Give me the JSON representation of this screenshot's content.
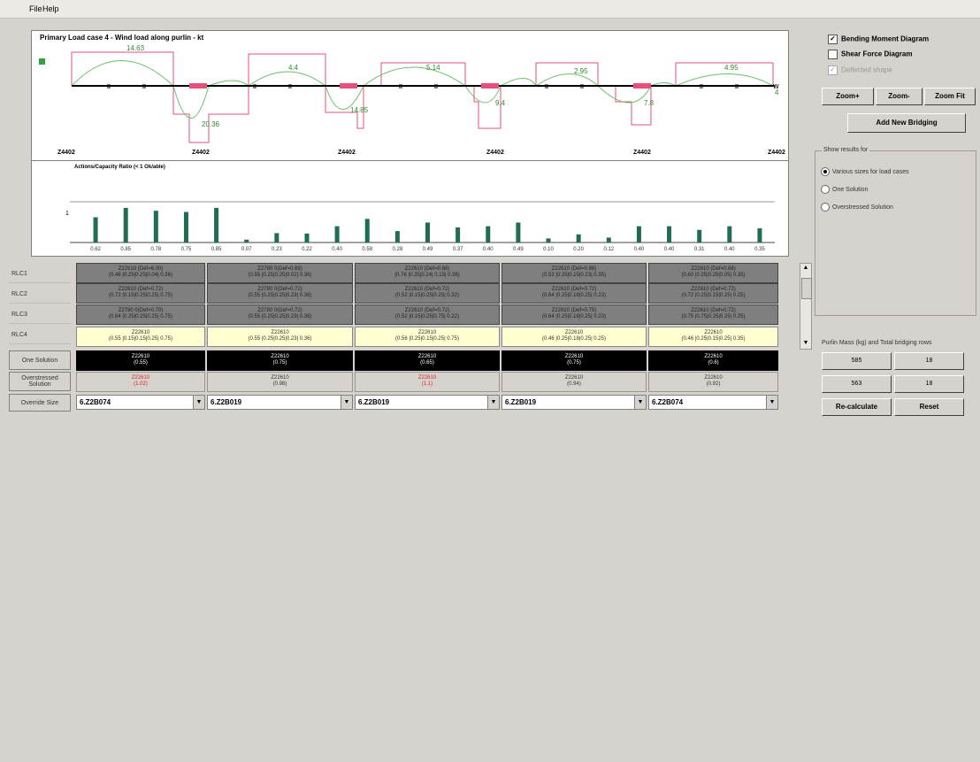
{
  "menu": {
    "file": "File",
    "help": "Help"
  },
  "bm_chart": {
    "title": "Primary Load case 4 - Wind load along purlin - kt",
    "moment_labels": [
      "14.63",
      "20.36",
      "4.4",
      "14.85",
      "5.14",
      "9.4",
      "2.95",
      "7.8",
      "4.95",
      "4"
    ],
    "support_labels": [
      "Z4402",
      "Z4402",
      "Z4402",
      "Z4402",
      "Z4402",
      "Z4402"
    ]
  },
  "ratio_chart": {
    "title": "Actions/Capacity Ratio (< 1 Ok/able)",
    "ref_line_label": "1",
    "chart_data": {
      "type": "bar",
      "values": [
        0.62,
        0.85,
        0.78,
        0.75,
        0.85,
        0.07,
        0.23,
        0.22,
        0.4,
        0.58,
        0.28,
        0.49,
        0.37,
        0.4,
        0.49,
        0.1,
        0.2,
        0.12,
        0.4,
        0.4,
        0.31,
        0.4,
        0.35
      ],
      "tick_labels": [
        "0.62",
        "0.85",
        "0.78",
        "0.75",
        "0.85",
        "0.07",
        "0.23",
        "0.22",
        "0.40",
        "0.58",
        "0.28",
        "0.49",
        "0.37",
        "0.40",
        "0.49",
        "0.10",
        "0.20",
        "0.12",
        "0.40",
        "0.40",
        "0.31",
        "0.40",
        "0.35"
      ],
      "ylim": [
        0,
        1.2
      ],
      "bar_color": "#1f6e50",
      "ref_line": 1
    }
  },
  "grid": {
    "row_labels": [
      "RLC1",
      "RLC2",
      "RLC3",
      "RLC4"
    ],
    "btn_row_labels": [
      "One Solution",
      "Overstressed Solution",
      "Override Size"
    ],
    "rows": [
      [
        [
          "Z22610 (Def=6.00)",
          "(0.46 |0.25|0.25|0.04| 0.36)"
        ],
        [
          "Z2780 0(Def=0.69)",
          "(0.55 |0.25|0.25|0.02| 0.36)"
        ],
        [
          "Z22610 (Def=0.68)",
          "(0.76 |0.25|0.24| 0.15| 0.36)"
        ],
        [
          "Z22610 (Def=0.88)",
          "(0.53 |0.25|0.15|0.23| 0.35)"
        ],
        [
          "Z22610 (Def=0.68)",
          "(0.60 |0.25|0.25|0.05| 0.35)"
        ]
      ],
      [
        [
          "Z22610 (Def=0.72)",
          "(0.72 |0.15|0.25|0.25| 0.75)"
        ],
        [
          "Z2780 0(Def=0.72)",
          "(0.55 |0.25|0.25|0.23| 0.36)"
        ],
        [
          "Z22610 (Def=0.72)",
          "(0.52 |0.15|0.25|0.25| 0.32)"
        ],
        [
          "Z22610 (Def=0.72)",
          "(0.64 |0.25|0.18|0.25| 0.23)"
        ],
        [
          "Z22610 (Def=0.72)",
          "(0.72 |0.25|0.15|0.25| 0.25)"
        ]
      ],
      [
        [
          "Z2780 0(Def=0.70)",
          "(0.64 |0.25|0.25|0.25| 0.75)"
        ],
        [
          "Z2780 0(Def=0.72)",
          "(0.55 |0.25|0.25|0.23| 0.36)"
        ],
        [
          "Z22610 (Def=0.72)",
          "(0.52 |0.15|0.25|0.75| 0.22)"
        ],
        [
          "Z22610 (Def=0.75)",
          "(0.64 |0.25|0.18|0.25| 0.23)"
        ],
        [
          "Z22610 (Def=0.72)",
          "(0.75 |0.75|0.25|0.25| 0.25)"
        ]
      ],
      [
        [
          "Z22610",
          "(0.55 |0.15|0.15|0.25| 0.75)"
        ],
        [
          "Z22610",
          "(0.55 |0.25|0.25|0.23| 0.36)"
        ],
        [
          "Z22610",
          "(0.56 |0.25|0.15|0.25| 0.75)"
        ],
        [
          "Z22610",
          "(0.46 |0.25|0.18|0.25| 0.25)"
        ],
        [
          "Z22610",
          "(0.46 |0.25|0.15|0.25| 0.35)"
        ]
      ]
    ],
    "one_solution": [
      [
        "Z22610",
        "(0.55)"
      ],
      [
        "Z22610",
        "(0.75)"
      ],
      [
        "Z22610",
        "(0.65)"
      ],
      [
        "Z22610",
        "(0.75)"
      ],
      [
        "Z22610",
        "(0.6)"
      ]
    ],
    "overstressed": [
      {
        "size": "Z22610",
        "ratio": "(1.02)",
        "red": true
      },
      {
        "size": "Z22610",
        "ratio": "(0.98)",
        "red": false
      },
      {
        "size": "Z22610",
        "ratio": "(1.1)",
        "red": true
      },
      {
        "size": "Z22610",
        "ratio": "(0.94)",
        "red": false
      },
      {
        "size": "Z22610",
        "ratio": "(0.92)",
        "red": false
      }
    ],
    "override": [
      "6.Z2B074",
      "6.Z2B019",
      "6.Z2B019",
      "6.Z2B019",
      "6.Z2B074"
    ]
  },
  "options": {
    "bending": "Bending Moment Diagram",
    "shear": "Shear Force Diagram",
    "deflected": "Deflected shape",
    "zoom_in": "Zoom+",
    "zoom_out": "Zoom-",
    "zoom_fit": "Zoom Fit",
    "add_bridging": "Add New Bridging",
    "show_results_title": "Show results for",
    "radio1": "Various sizes for load cases",
    "radio2": "One Solution",
    "radio3": "Overstressed Solution",
    "weights_title": "Purlin Mass (kg) and Total bridging rows",
    "w1": "585",
    "w2": "18",
    "w3": "563",
    "w4": "18",
    "recalculate": "Re-calculate",
    "reset": "Reset"
  }
}
